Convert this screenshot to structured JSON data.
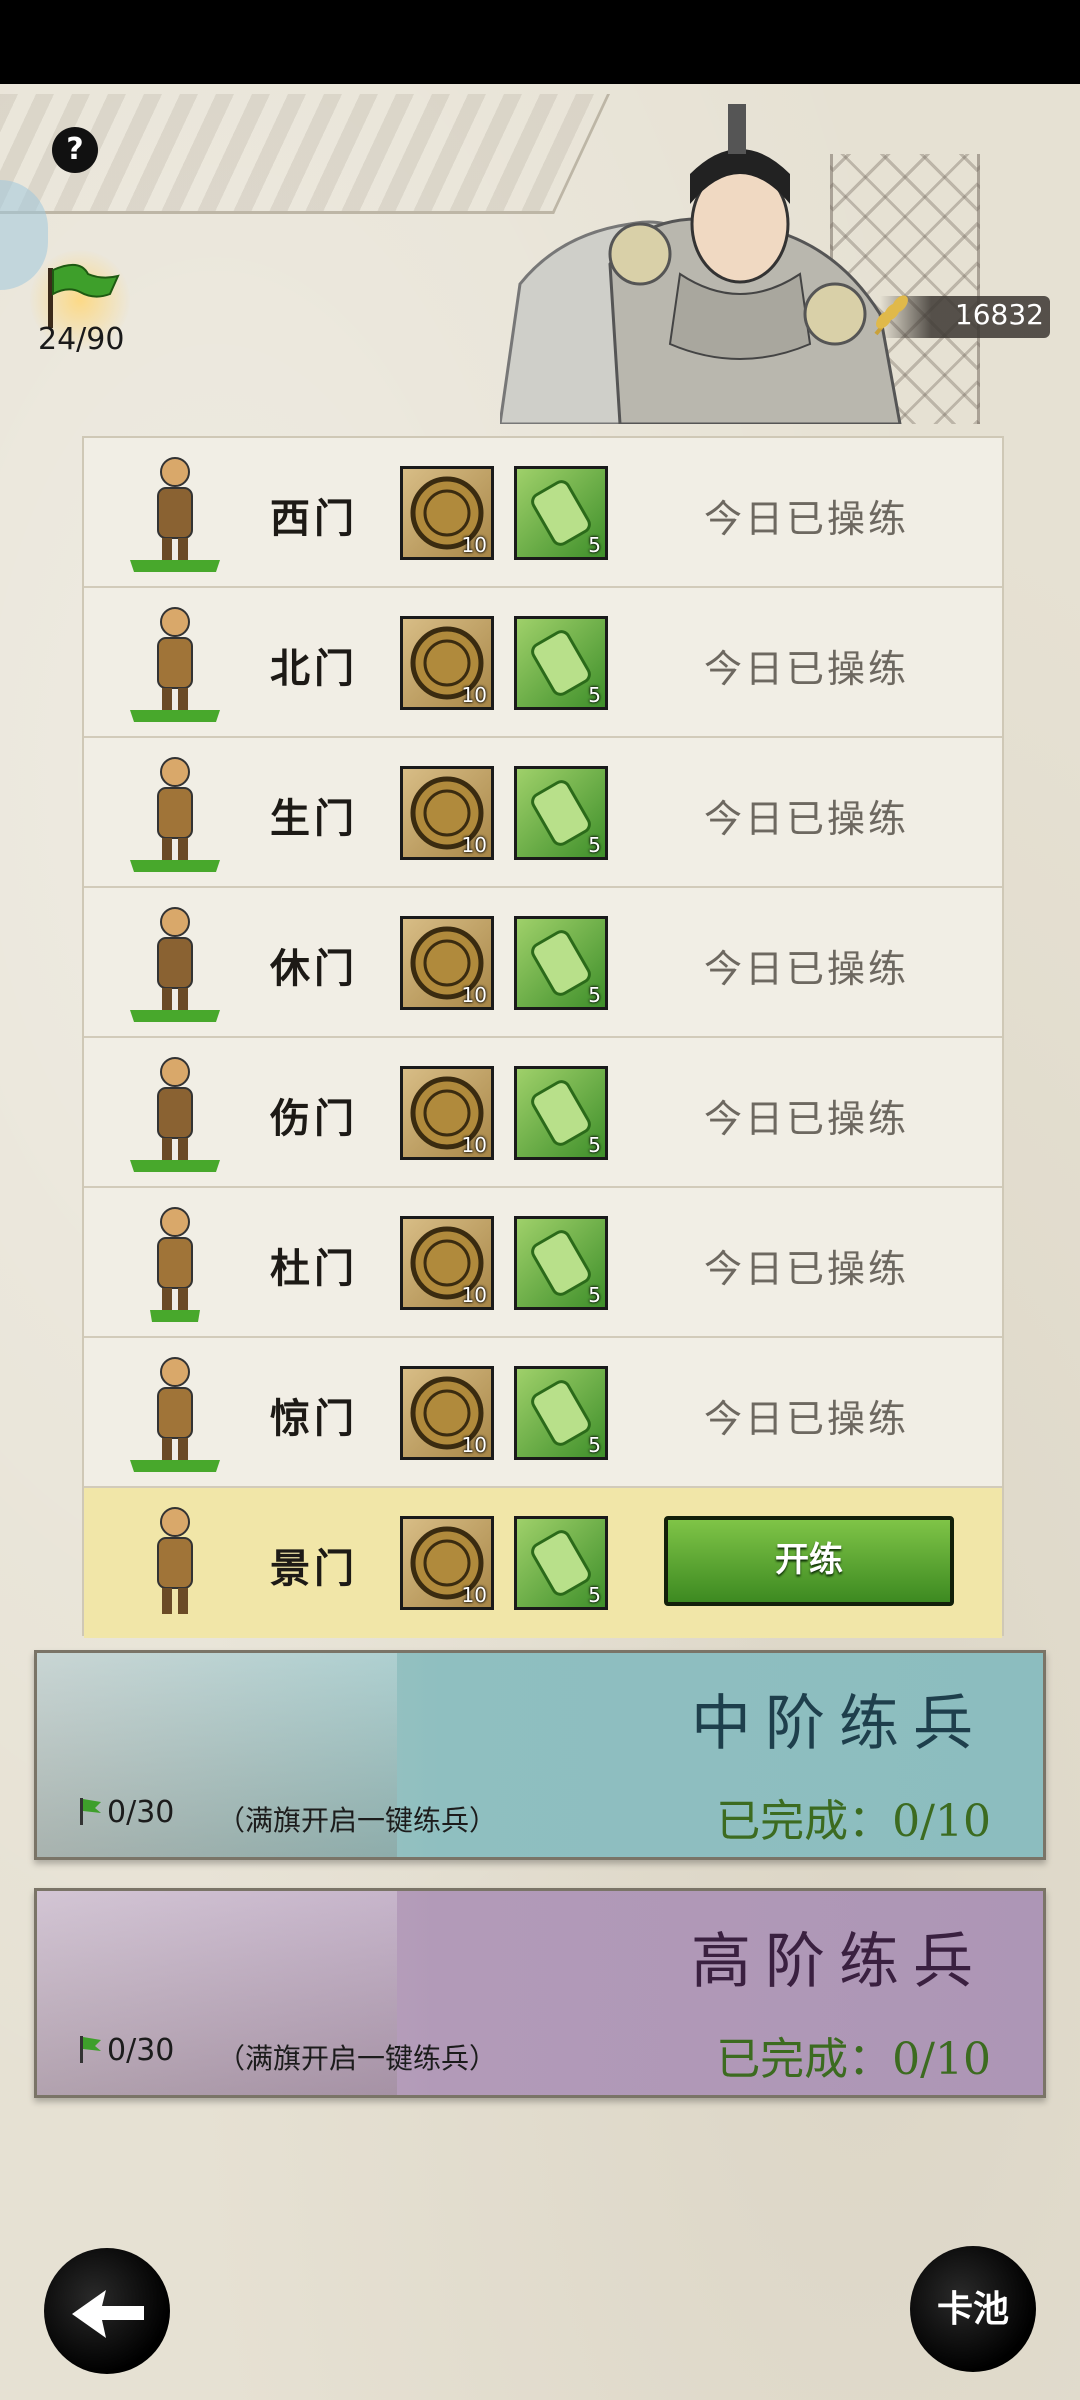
{
  "header": {
    "help_label": "?",
    "flag_count": "24/90",
    "grain_value": "16832"
  },
  "rows": [
    {
      "name": "西门",
      "coin_qty": "10",
      "scroll_qty": "5",
      "status": "今日已操练"
    },
    {
      "name": "北门",
      "coin_qty": "10",
      "scroll_qty": "5",
      "status": "今日已操练"
    },
    {
      "name": "生门",
      "coin_qty": "10",
      "scroll_qty": "5",
      "status": "今日已操练"
    },
    {
      "name": "休门",
      "coin_qty": "10",
      "scroll_qty": "5",
      "status": "今日已操练"
    },
    {
      "name": "伤门",
      "coin_qty": "10",
      "scroll_qty": "5",
      "status": "今日已操练"
    },
    {
      "name": "杜门",
      "coin_qty": "10",
      "scroll_qty": "5",
      "status": "今日已操练"
    },
    {
      "name": "惊门",
      "coin_qty": "10",
      "scroll_qty": "5",
      "status": "今日已操练"
    },
    {
      "name": "景门",
      "coin_qty": "10",
      "scroll_qty": "5",
      "button": "开练"
    }
  ],
  "panels": {
    "mid": {
      "title": "中阶练兵",
      "flag_progress": "0/30",
      "hint": "（满旗开启一键练兵）",
      "done": "已完成：0/10"
    },
    "high": {
      "title": "高阶练兵",
      "flag_progress": "0/30",
      "hint": "（满旗开启一键练兵）",
      "done": "已完成：0/10"
    }
  },
  "footer": {
    "pool_label": "卡池"
  },
  "colors": {
    "train_button": "#4fa22c",
    "active_row": "#f1e6a8",
    "mid_panel": "#8fbfc0",
    "high_panel": "#b29ab8"
  }
}
